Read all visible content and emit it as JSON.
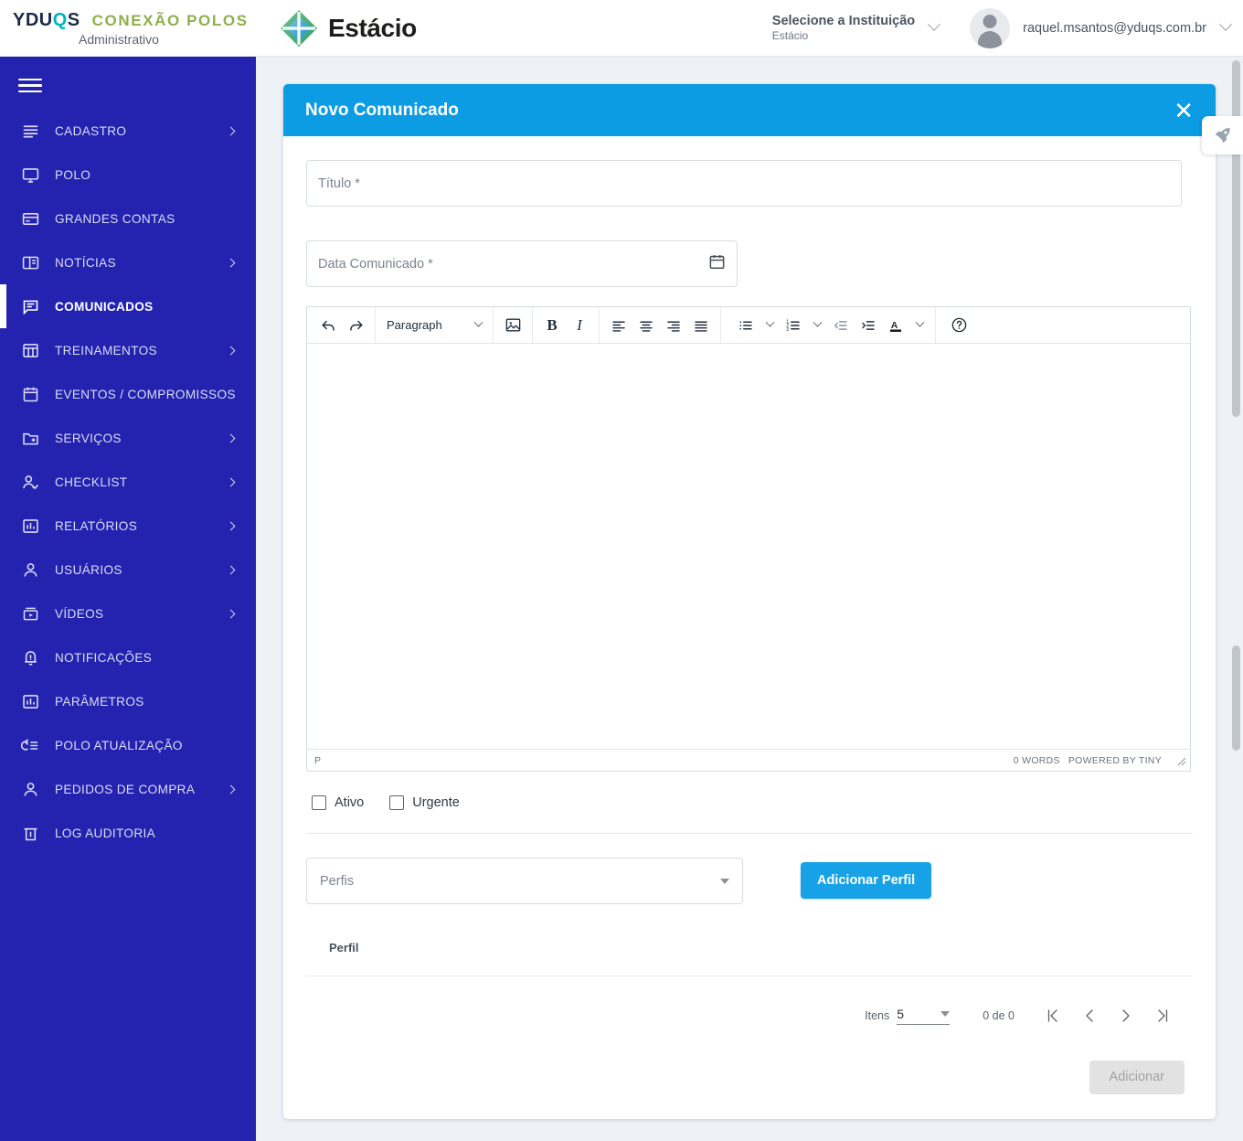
{
  "topbar": {
    "brand_yduqs": "YDUQS",
    "brand_yduqs_prefix": "YDU",
    "brand_yduqs_q": "Q",
    "brand_yduqs_suffix": "S",
    "brand_conexao": "CONEXÃO POLOS",
    "brand_admin": "Administrativo",
    "estacio_label": "Estácio",
    "institution_title": "Selecione a Instituição",
    "institution_value": "Estácio",
    "user_email": "raquel.msantos@yduqs.com.br"
  },
  "sidebar": {
    "items": [
      {
        "label": "CADASTRO",
        "icon": "list-icon",
        "arrow": true,
        "active": false
      },
      {
        "label": "POLO",
        "icon": "monitor-icon",
        "arrow": false,
        "active": false
      },
      {
        "label": "GRANDES CONTAS",
        "icon": "card-icon",
        "arrow": false,
        "active": false
      },
      {
        "label": "NOTÍCIAS",
        "icon": "news-icon",
        "arrow": true,
        "active": false
      },
      {
        "label": "COMUNICADOS",
        "icon": "message-icon",
        "arrow": false,
        "active": true
      },
      {
        "label": "TREINAMENTOS",
        "icon": "table-icon",
        "arrow": true,
        "active": false
      },
      {
        "label": "EVENTOS / COMPROMISSOS",
        "icon": "calendar-icon",
        "arrow": false,
        "active": false
      },
      {
        "label": "SERVIÇOS",
        "icon": "folder-plus-icon",
        "arrow": true,
        "active": false
      },
      {
        "label": "CHECKLIST",
        "icon": "user-check-icon",
        "arrow": true,
        "active": false
      },
      {
        "label": "RELATÓRIOS",
        "icon": "chart-icon",
        "arrow": true,
        "active": false
      },
      {
        "label": "USUÁRIOS",
        "icon": "user-icon",
        "arrow": true,
        "active": false
      },
      {
        "label": "VÍDEOS",
        "icon": "video-icon",
        "arrow": true,
        "active": false
      },
      {
        "label": "NOTIFICAÇÕES",
        "icon": "bell-icon",
        "arrow": false,
        "active": false
      },
      {
        "label": "PARÂMETROS",
        "icon": "chart-icon",
        "arrow": false,
        "active": false
      },
      {
        "label": "POLO ATUALIZAÇÃO",
        "icon": "sync-list-icon",
        "arrow": false,
        "active": false
      },
      {
        "label": "PEDIDOS DE COMPRA",
        "icon": "user-icon",
        "arrow": true,
        "active": false
      },
      {
        "label": "LOG AUDITORIA",
        "icon": "trash-icon",
        "arrow": false,
        "active": false
      }
    ]
  },
  "dialog": {
    "title": "Novo Comunicado",
    "close_label": "✕",
    "fields": {
      "titulo_placeholder": "Título *",
      "data_placeholder": "Data Comunicado *"
    },
    "editor": {
      "format_select": "Paragraph",
      "status_path": "p",
      "word_count": "0 WORDS",
      "branding": "POWERED BY TINY",
      "toolbar": [
        "undo-icon",
        "redo-icon",
        "format-select",
        "image-icon",
        "bold-icon",
        "italic-icon",
        "align-left-icon",
        "align-center-icon",
        "align-right-icon",
        "align-justify-icon",
        "bullet-list-icon",
        "numbered-list-icon",
        "outdent-icon",
        "indent-icon",
        "text-color-icon",
        "help-icon"
      ]
    },
    "checkboxes": [
      {
        "label": "Ativo",
        "checked": false
      },
      {
        "label": "Urgente",
        "checked": false
      }
    ],
    "perfis": {
      "select_placeholder": "Perfis",
      "add_button": "Adicionar Perfil",
      "table_header": "Perfil"
    },
    "pager": {
      "items_label": "Itens",
      "items_value": "5",
      "range": "0 de 0",
      "first_label": "|❬",
      "prev_label": "❬",
      "next_label": "❭",
      "last_label": "❭|"
    },
    "submit_label": "Adicionar"
  },
  "floating": {
    "rocket_tab": "rocket-icon"
  },
  "colors": {
    "sidebar": "#2323b0",
    "dialog_header": "#0b9ce3",
    "accent_button": "#17a2e8",
    "brand_green": "#8fb04a",
    "brand_teal": "#00b5b8",
    "page_bg": "#eef2f7"
  }
}
